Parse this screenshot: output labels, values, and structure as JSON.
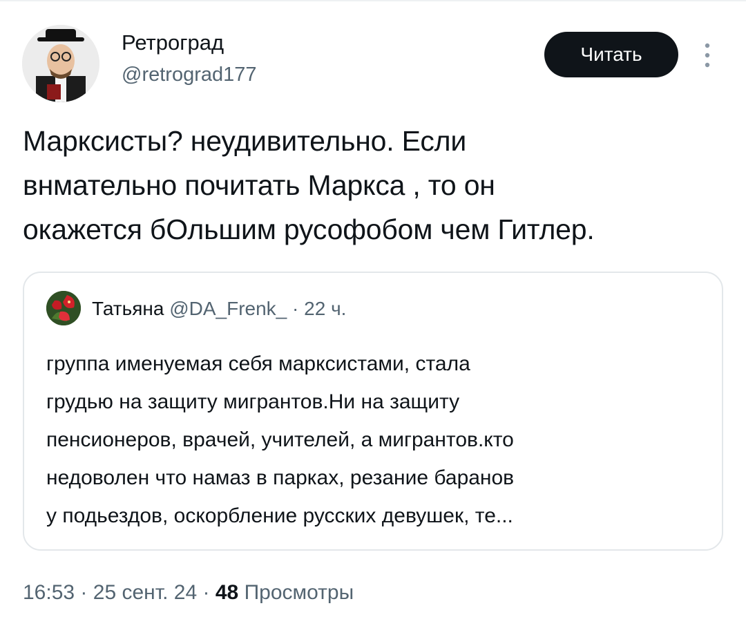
{
  "author": {
    "name": "Ретроград",
    "handle": "@retrograd177",
    "avatar_icon": "person-photo-avatar"
  },
  "follow_button": {
    "label": "Читать"
  },
  "more_icon": "vertical-dots-icon",
  "tweet": {
    "lines": [
      "Марксисты? неудивительно. Если",
      "внмательно почитать Маркса , то он",
      "окажется бОльшим русофобом чем Гитлер."
    ]
  },
  "quote": {
    "author_name": "Татьяна",
    "author_handle": "@DA_Frenk_",
    "separator": "·",
    "time": "22 ч.",
    "avatar_icon": "red-flower-avatar",
    "lines": [
      "группа именуемая себя марксистами, стала",
      "грудью на защиту мигрантов.Ни на защиту",
      "пенсионеров, врачей, учителей, а мигрантов.кто",
      "недоволен что намаз в парках, резание баранов",
      "у подьездов, оскорбление русских девушек, те..."
    ]
  },
  "footer": {
    "time": "16:53",
    "sep1": "·",
    "date": "25 сент. 24",
    "sep2": "·",
    "views_count": "48",
    "views_label": "Просмотры"
  },
  "colors": {
    "text_primary": "#0f1419",
    "text_secondary": "#536471",
    "border": "#e3e7ea",
    "button_bg": "#0f1419",
    "button_text": "#ffffff"
  }
}
